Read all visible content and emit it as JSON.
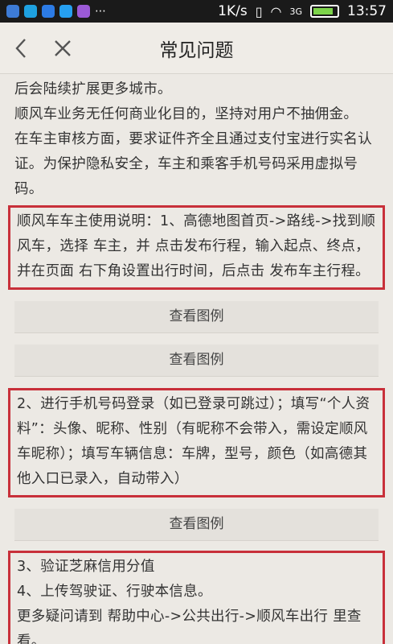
{
  "status_bar": {
    "speed": "1K/s",
    "network": "3G",
    "time": "13:57",
    "battery_level": 0.85,
    "app_icon_colors": [
      "#3d7bd6",
      "#1ea1e0",
      "#2c7be5",
      "#26a0f0",
      "#9b5ad6"
    ]
  },
  "nav": {
    "back_icon": "chevron-left-icon",
    "close_icon": "close-icon",
    "title": "常见问题"
  },
  "content": {
    "intro_lines": [
      "后会陆续扩展更多城市。",
      "顺风车业务无任何商业化目的，坚持对用户不抽佣金。",
      "在车主审核方面，要求证件齐全且通过支付宝进行实名认证。为保护隐私安全，车主和乘客手机号码采用虚拟号码。"
    ],
    "box1_text": "顺风车车主使用说明：1、高德地图首页->路线->找到顺风车，选择 车主，并 点击发布行程，输入起点、终点，并在页面 右下角设置出行时间，后点击 发布车主行程。",
    "view_example_1": "查看图例",
    "view_example_2": "查看图例",
    "box2_text": "2、进行手机号码登录（如已登录可跳过）；填写“个人资料”：头像、昵称、性别（有昵称不会带入，需设定顺风车昵称）；填写车辆信息：车牌，型号，颜色（如高德其他入口已录入，自动带入）",
    "view_example_3": "查看图例",
    "box3_lines": [
      "3、验证芝麻信用分值",
      "4、上传驾驶证、行驶本信息。",
      "更多疑问请到 帮助中心->公共出行->顺风车出行 里查看。"
    ]
  },
  "colors": {
    "highlight_border": "#c8303a",
    "background": "#ece9e4"
  }
}
